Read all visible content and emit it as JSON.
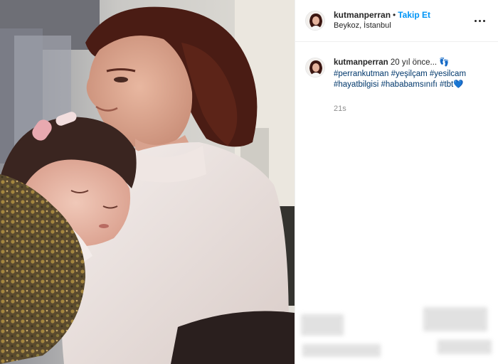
{
  "post": {
    "username": "kutmanperran",
    "separator": "•",
    "follow_label": "Takip Et",
    "location": "Beykoz, İstanbul",
    "more_icon": "more-options-icon"
  },
  "caption": {
    "username": "kutmanperran",
    "text": "20 yıl önce... ",
    "emoji": "👣",
    "hashtags": [
      "#perrankutman",
      "#yeşilçam",
      "#yesilcam",
      "#hayatbilgisi",
      "#hababamsınıfı",
      "#tbt"
    ],
    "heart": "💙",
    "timestamp": "21s"
  },
  "colors": {
    "follow": "#0095f6",
    "hashtag": "#00376b",
    "muted": "#8e8e8e"
  }
}
